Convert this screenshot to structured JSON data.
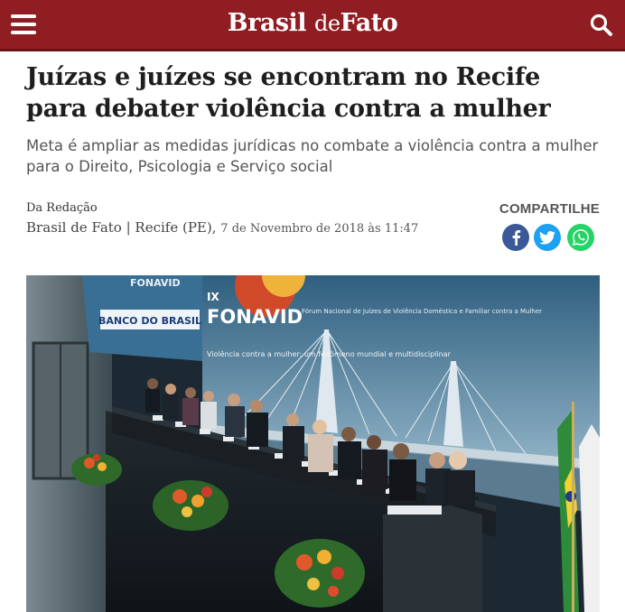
{
  "header": {
    "logo_main": "Brasil",
    "logo_de": "de",
    "logo_end": "Fato",
    "menu_icon": "hamburger-menu-icon",
    "search_icon": "search-icon",
    "bar_color": "#8f1d22"
  },
  "article": {
    "headline": "Juízas e juízes se encontram no Recife para debater violência contra a mulher",
    "subtitle": "Meta é ampliar as medidas jurídicas no combate a violência contra a mulher para o Direito, Psicologia e Serviço social",
    "byline_label": "Da Redação",
    "byline_source": "Brasil de Fato | Recife (PE),",
    "byline_date": "7 de Novembro de 2018 às 11:47"
  },
  "share": {
    "label": "COMPARTILHE",
    "facebook_icon": "facebook-icon",
    "twitter_icon": "twitter-icon",
    "whatsapp_icon": "whatsapp-icon"
  },
  "photo": {
    "screen_text_1": "IX",
    "screen_text_2": "FONAVID",
    "screen_text_3": "Fórum Nacional de Juízes de Violência Doméstica e Familiar contra a Mulher",
    "screen_text_4": "Violência contra a mulher: um fenômeno mundial e multidisciplinar",
    "bank_text": "BANCO DO BRASIL",
    "top_logo_text": "FONAVID"
  }
}
